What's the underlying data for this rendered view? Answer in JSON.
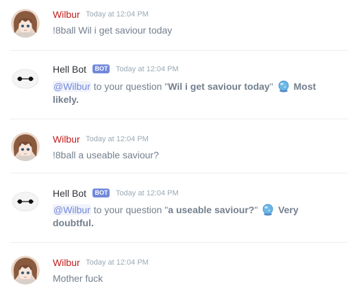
{
  "messages": [
    {
      "author": "Wilbur",
      "timestamp": "Today at 12:04 PM",
      "text": "!8ball Wil i get saviour today"
    },
    {
      "author": "Hell Bot",
      "badge": "BOT",
      "timestamp": "Today at 12:04 PM",
      "mention": "@Wilbur",
      "prefix": " to your question \"",
      "question": "Wil i get saviour today",
      "suffix": "\" ",
      "answer": "Most likely."
    },
    {
      "author": "Wilbur",
      "timestamp": "Today at 12:04 PM",
      "text": "!8ball a useable saviour?"
    },
    {
      "author": "Hell Bot",
      "badge": "BOT",
      "timestamp": "Today at 12:04 PM",
      "mention": "@Wilbur",
      "prefix": " to your question \"",
      "question": "a useable saviour?",
      "suffix": "\" ",
      "answer": "Very doubtful."
    },
    {
      "author": "Wilbur",
      "timestamp": "Today at 12:04 PM",
      "text": "Mother fuck"
    }
  ],
  "colors": {
    "user_name": "#c21b1b",
    "bot_name": "#2e3136",
    "bot_badge": "#7289da",
    "mention": "#7289da"
  },
  "icons": {
    "user_avatar": "anime-girl-avatar-icon",
    "bot_avatar": "white-robot-avatar-icon",
    "answer_emoji": "crystal-ball-icon"
  }
}
